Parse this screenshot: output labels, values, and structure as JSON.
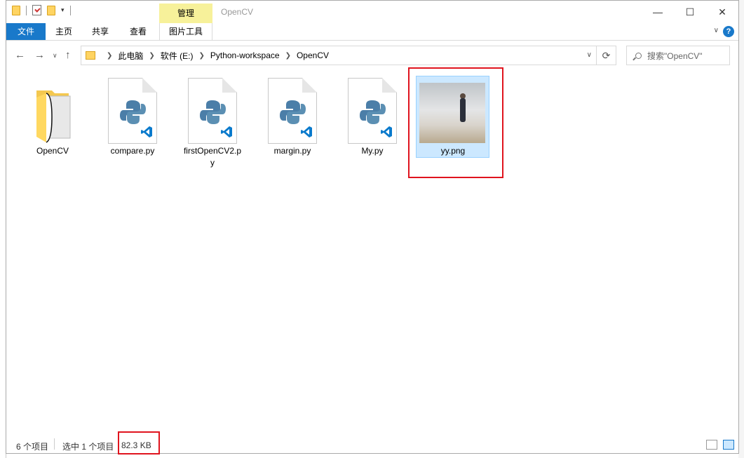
{
  "window": {
    "title": "OpenCV",
    "context_tab": "管理",
    "minimize": "—",
    "maximize": "☐",
    "close": "✕"
  },
  "ribbon": {
    "tabs": [
      "文件",
      "主页",
      "共享",
      "查看"
    ],
    "picture_tools": "图片工具",
    "help": "?"
  },
  "nav": {
    "breadcrumb": [
      "此电脑",
      "软件 (E:)",
      "Python-workspace",
      "OpenCV"
    ],
    "search_placeholder": "搜索\"OpenCV\""
  },
  "items": [
    {
      "name": "OpenCV",
      "type": "folder"
    },
    {
      "name": "compare.py",
      "type": "python"
    },
    {
      "name": "firstOpenCV2.py",
      "type": "python"
    },
    {
      "name": "margin.py",
      "type": "python"
    },
    {
      "name": "My.py",
      "type": "python"
    },
    {
      "name": "yy.png",
      "type": "image",
      "selected": true
    }
  ],
  "status": {
    "count": "6 个项目",
    "selected": "选中 1 个项目",
    "size": "82.3 KB"
  },
  "colors": {
    "accent": "#1979ca",
    "highlight_border": "#e0141e",
    "selection": "#cce8ff",
    "context_tab": "#f7f19a"
  }
}
